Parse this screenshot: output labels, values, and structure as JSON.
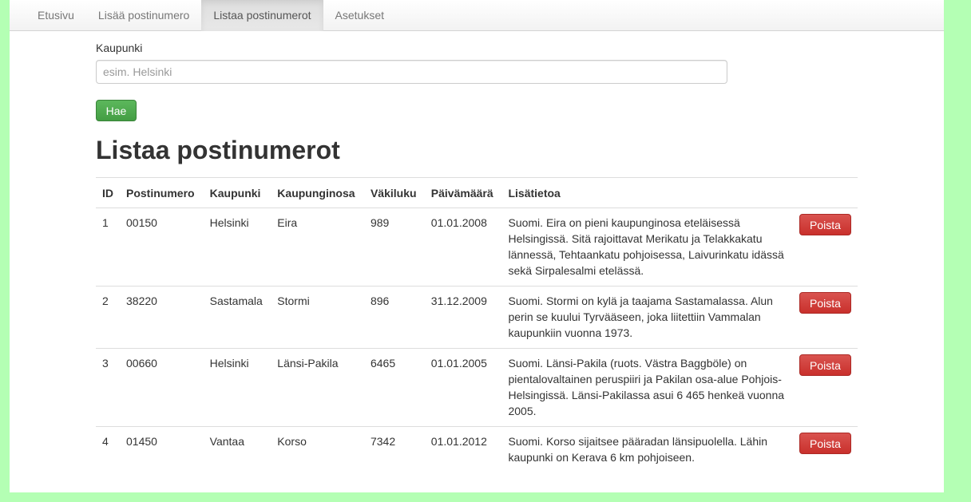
{
  "nav": {
    "items": [
      {
        "label": "Etusivu"
      },
      {
        "label": "Lisää postinumero"
      },
      {
        "label": "Listaa postinumerot"
      },
      {
        "label": "Asetukset"
      }
    ]
  },
  "search": {
    "label": "Kaupunki",
    "placeholder": "esim. Helsinki",
    "value": "",
    "button_label": "Hae"
  },
  "page_title": "Listaa postinumerot",
  "table": {
    "headers": {
      "id": "ID",
      "postal_code": "Postinumero",
      "city": "Kaupunki",
      "district": "Kaupunginosa",
      "population": "Väkiluku",
      "date": "Päivämäärä",
      "info": "Lisätietoa"
    },
    "rows": [
      {
        "id": "1",
        "postal_code": "00150",
        "city": "Helsinki",
        "district": "Eira",
        "population": "989",
        "date": "01.01.2008",
        "info": "Suomi. Eira on pieni kaupunginosa eteläisessä Helsingissä. Sitä rajoittavat Merikatu ja Telakkakatu lännessä, Tehtaankatu pohjoisessa, Laivurinkatu idässä sekä Sirpalesalmi etelässä.",
        "action": "Poista"
      },
      {
        "id": "2",
        "postal_code": "38220",
        "city": "Sastamala",
        "district": "Stormi",
        "population": "896",
        "date": "31.12.2009",
        "info": "Suomi. Stormi on kylä ja taajama Sastamalassa. Alun perin se kuului Tyrvääseen, joka liitettiin Vammalan kaupunkiin vuonna 1973.",
        "action": "Poista"
      },
      {
        "id": "3",
        "postal_code": "00660",
        "city": "Helsinki",
        "district": "Länsi-Pakila",
        "population": "6465",
        "date": "01.01.2005",
        "info": "Suomi. Länsi-Pakila (ruots. Västra Baggböle) on pientalovaltainen peruspiiri ja Pakilan osa-alue Pohjois-Helsingissä. Länsi-Pakilassa asui 6 465 henkeä vuonna 2005.",
        "action": "Poista"
      },
      {
        "id": "4",
        "postal_code": "01450",
        "city": "Vantaa",
        "district": "Korso",
        "population": "7342",
        "date": "01.01.2012",
        "info": "Suomi. Korso sijaitsee pääradan länsipuolella. Lähin kaupunki on Kerava 6 km pohjoiseen.",
        "action": "Poista"
      }
    ]
  }
}
